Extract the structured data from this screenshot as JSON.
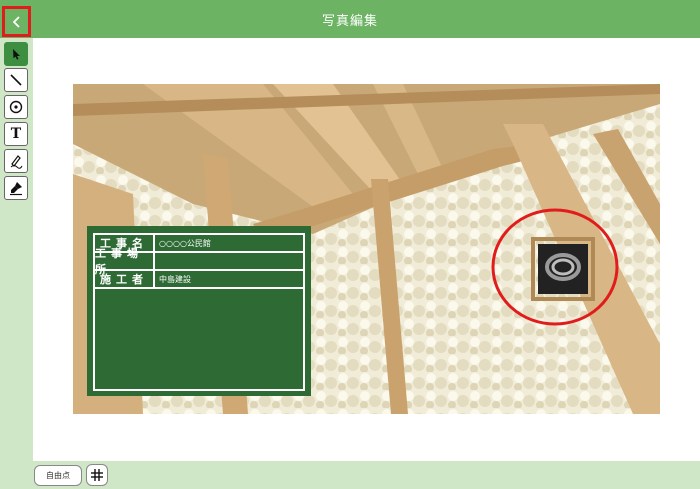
{
  "header": {
    "title": "写真編集",
    "back_icon": "chevron-left-icon"
  },
  "toolbar": {
    "tools": [
      {
        "name": "select",
        "icon": "arrow-pointer-icon",
        "active": true
      },
      {
        "name": "line",
        "icon": "line-icon",
        "active": false
      },
      {
        "name": "circle",
        "icon": "circle-target-icon",
        "active": false
      },
      {
        "name": "text",
        "icon": "text-icon",
        "glyph": "T",
        "active": false
      },
      {
        "name": "pen",
        "icon": "pen-icon",
        "active": false
      },
      {
        "name": "brush",
        "icon": "brush-icon",
        "active": false
      }
    ]
  },
  "blackboard": {
    "rows": [
      {
        "label": "工事名",
        "value": "○○○○公民館"
      },
      {
        "label": "工事場所",
        "value": ""
      },
      {
        "label": "施工者",
        "value": "中島建設"
      }
    ]
  },
  "footer": {
    "free_point_label": "自由点",
    "grid_icon": "grid-icon"
  },
  "colors": {
    "header": "#6cb363",
    "toolbar": "#cfe6c7",
    "blackboard": "#2e6b34",
    "highlight": "#e01c1c"
  }
}
